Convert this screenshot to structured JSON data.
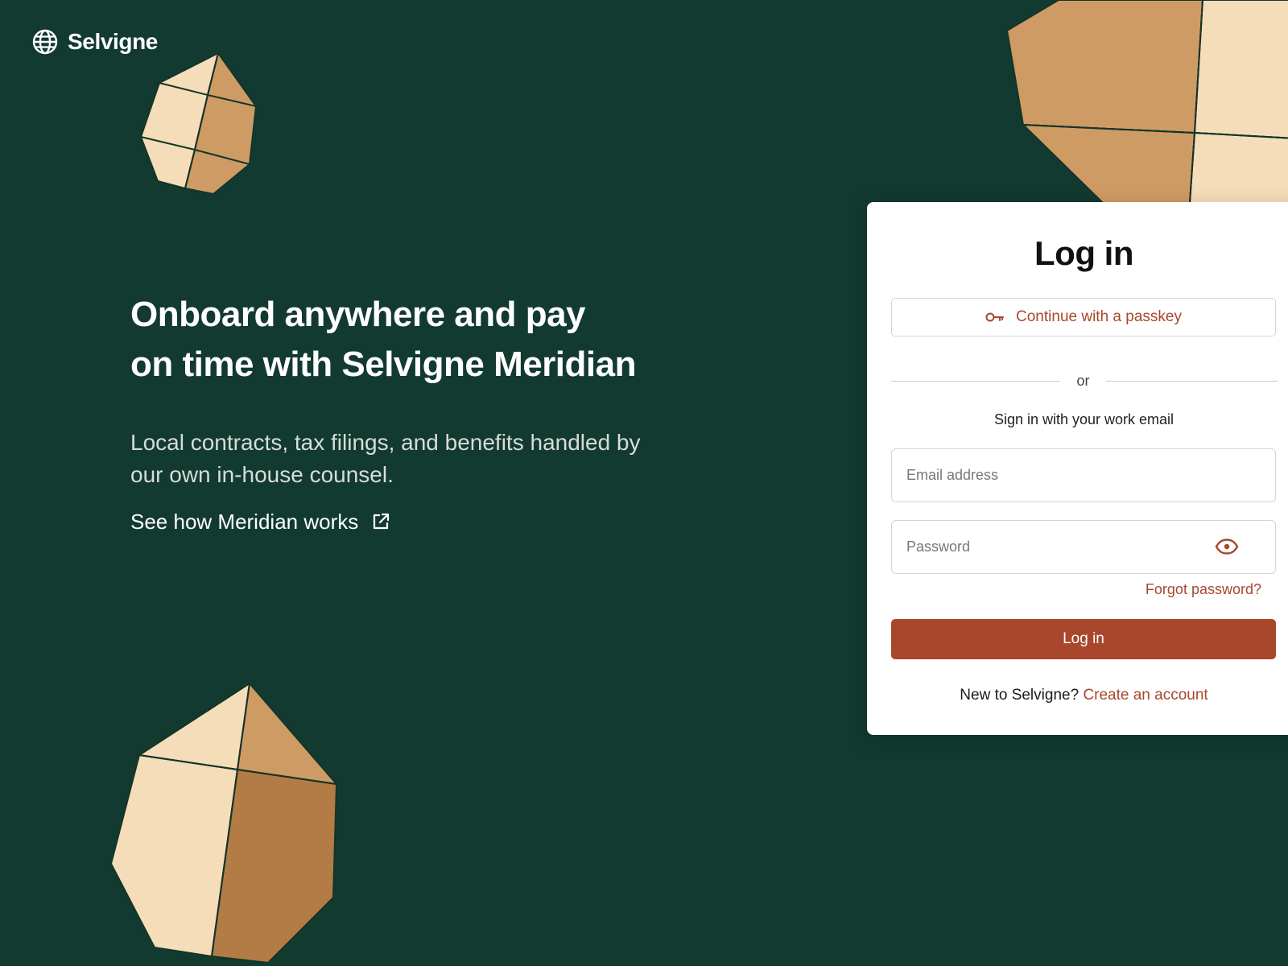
{
  "brand": {
    "name": "Selvigne",
    "icon": "globe-icon"
  },
  "hero": {
    "title_line1": "Onboard anywhere and pay",
    "title_line2": "on time with Selvigne Meridian",
    "subtitle": "Local contracts, tax filings, and benefits handled by our own in-house counsel.",
    "link_label": "See how Meridian works",
    "link_icon": "external-link-icon"
  },
  "login": {
    "title": "Log in",
    "passkey_label": "Continue with a passkey",
    "passkey_icon": "key-icon",
    "divider_text": "or",
    "subhead": "Sign in with your work email",
    "email_placeholder": "Email address",
    "password_placeholder": "Password",
    "password_toggle_icon": "eye-icon",
    "forgot_label": "Forgot password?",
    "submit_label": "Log in",
    "signup_prompt": "New to Selvigne?",
    "signup_link": "Create an account"
  },
  "colors": {
    "background": "#123a30",
    "accent": "#a8472c",
    "facet_light": "#f6ddb9",
    "facet_mid": "#cf9b65",
    "facet_dark": "#b37b45"
  }
}
